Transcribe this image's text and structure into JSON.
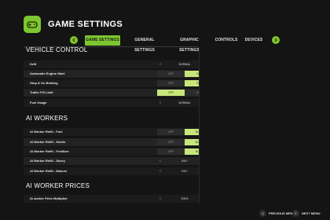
{
  "window": {
    "title": "GAME SETTINGS"
  },
  "tabs": [
    {
      "label": "GAME SETTINGS",
      "active": true
    },
    {
      "label": "GENERAL SETTINGS",
      "active": false
    },
    {
      "label": "GRAPHIC SETTINGS",
      "active": false
    },
    {
      "label": "CONTROLS",
      "active": false
    },
    {
      "label": "DEVICES",
      "active": false
    }
  ],
  "tab_arrows": {
    "left_icon": "chevron-left-icon",
    "right_icon": "chevron-right-icon"
  },
  "sections": {
    "vehicle_control": {
      "title": "VEHICLE CONTROL",
      "rows": [
        {
          "label": "Drift",
          "type": "select",
          "value": "NORMAL"
        },
        {
          "label": "Automatic Engine Start",
          "type": "toggle",
          "off_label": "OFF",
          "on_label": "ON",
          "selected": "ON"
        },
        {
          "label": "Stop & Go Braking",
          "type": "toggle",
          "off_label": "OFF",
          "on_label": "ON",
          "selected": "ON"
        },
        {
          "label": "Trailer Fill Limit",
          "type": "toggle",
          "off_label": "OFF",
          "on_label": "ON",
          "selected": "OFF"
        },
        {
          "label": "Fuel Usage",
          "type": "select",
          "value": "NORMAL"
        }
      ]
    },
    "ai_workers": {
      "title": "AI WORKERS",
      "rows": [
        {
          "label": "AI Worker Refill - Fuel",
          "type": "toggle",
          "off_label": "OFF",
          "on_label": "BUY",
          "selected": "BUY"
        },
        {
          "label": "AI Worker Refill - Seeds",
          "type": "toggle",
          "off_label": "OFF",
          "on_label": "BUY",
          "selected": "BUY"
        },
        {
          "label": "AI Worker Refill - Fertilizer",
          "type": "toggle",
          "off_label": "OFF",
          "on_label": "BUY",
          "selected": "BUY"
        },
        {
          "label": "AI Worker Refill - Slurry",
          "type": "select",
          "value": "BUY"
        },
        {
          "label": "AI Worker Refill - Manure",
          "type": "select",
          "value": "BUY"
        }
      ]
    },
    "ai_worker_prices": {
      "title": "AI WORKER PRICES",
      "rows": [
        {
          "label": "IA worker Price Multiplier",
          "type": "select",
          "value": "200%"
        }
      ]
    }
  },
  "footer": {
    "previous": {
      "key": "Q",
      "label": "PREVIOUS MENU"
    },
    "next": {
      "key": "E",
      "label": "NEXT MENU"
    }
  },
  "colors": {
    "accent": "#7ec62f",
    "toggle_selected": "#c7e67b",
    "background": "#141414"
  }
}
